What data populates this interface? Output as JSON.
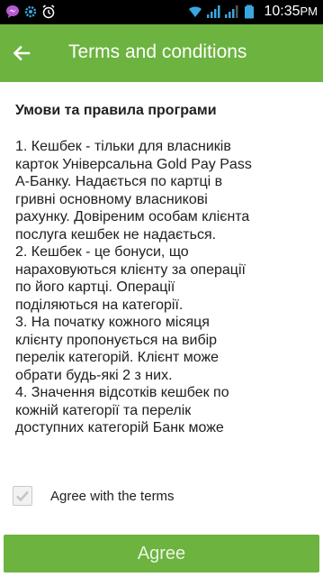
{
  "status_bar": {
    "time": "10:35",
    "ampm": "PM",
    "icons": [
      "messenger-icon",
      "settings-icon",
      "alarm-icon",
      "wifi-icon",
      "signal-icon",
      "signal-icon",
      "battery-icon"
    ]
  },
  "app_bar": {
    "back_icon": "arrow-left-icon",
    "title": "Terms and conditions"
  },
  "terms": {
    "heading": "Умови та правила програми",
    "lines": [
      "1. Кешбек - тільки для власників",
      "карток Універсальна Gold Pay Pass",
      "А-Банку. Надається по картці в",
      "гривні основному власникові",
      "рахунку. Довіреним особам клієнта",
      "послуга кешбек не надається.",
      "2. Кешбек - це бонуси, що",
      "нараховуються клієнту за операції",
      "по його картці. Операції",
      "поділяються на категорії.",
      "3. На початку кожного місяця",
      "клієнту пропонується на вибір",
      "перелік категорій. Клієнт може",
      "обрати будь-які 2 з них.",
      "4. Значення відсотків кешбек по",
      "кожній категорії та перелік",
      "доступних категорій Банк може"
    ]
  },
  "agree_checkbox": {
    "label": "Agree with the terms",
    "checked": true
  },
  "agree_button": {
    "label": "Agree"
  },
  "colors": {
    "accent": "#6cb33f",
    "status_icon": "#3aa8e0"
  }
}
